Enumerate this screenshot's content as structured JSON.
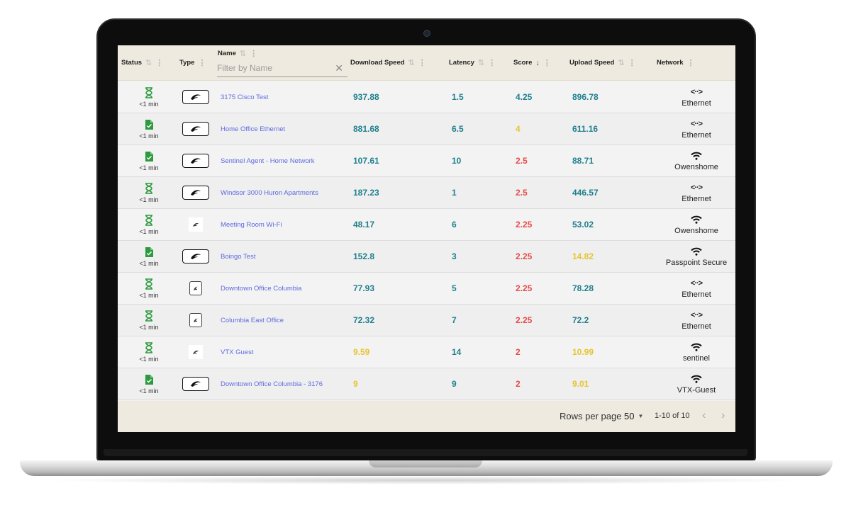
{
  "columns": {
    "status": "Status",
    "type": "Type",
    "name": "Name",
    "download": "Download Speed",
    "latency": "Latency",
    "score": "Score",
    "upload": "Upload Speed",
    "network": "Network"
  },
  "filter": {
    "placeholder": "Filter by Name",
    "value": ""
  },
  "colors": {
    "teal": "#1f7f8e",
    "yellow": "#e6c531",
    "red": "#e64b4b",
    "link": "#5d6be0",
    "header_bg": "#eeeadf"
  },
  "rows": [
    {
      "status_icon": "hourglass-icon",
      "status": "<1 min",
      "type_icon": "agent-device-icon",
      "name": "3175 Cisco Test",
      "download": "937.88",
      "download_color": "teal",
      "latency": "1.5",
      "score": "4.25",
      "score_color": "teal",
      "upload": "896.78",
      "upload_color": "teal",
      "network_icon": "ethernet-icon",
      "network": "Ethernet"
    },
    {
      "status_icon": "file-check-icon",
      "status": "<1 min",
      "type_icon": "agent-device-icon",
      "name": "Home Office Ethernet",
      "download": "881.68",
      "download_color": "teal",
      "latency": "6.5",
      "score": "4",
      "score_color": "yellow",
      "upload": "611.16",
      "upload_color": "teal",
      "network_icon": "ethernet-icon",
      "network": "Ethernet"
    },
    {
      "status_icon": "file-check-icon",
      "status": "<1 min",
      "type_icon": "agent-device-icon",
      "name": "Sentinel Agent - Home Network",
      "download": "107.61",
      "download_color": "teal",
      "latency": "10",
      "score": "2.5",
      "score_color": "red",
      "upload": "88.71",
      "upload_color": "teal",
      "network_icon": "wifi-icon",
      "network": "Owenshome"
    },
    {
      "status_icon": "hourglass-icon",
      "status": "<1 min",
      "type_icon": "agent-device-icon",
      "name": "Windsor 3000 Huron Apartments",
      "download": "187.23",
      "download_color": "teal",
      "latency": "1",
      "score": "2.5",
      "score_color": "red",
      "upload": "446.57",
      "upload_color": "teal",
      "network_icon": "ethernet-icon",
      "network": "Ethernet"
    },
    {
      "status_icon": "hourglass-icon",
      "status": "<1 min",
      "type_icon": "app-device-icon",
      "name": "Meeting Room Wi-Fi",
      "download": "48.17",
      "download_color": "teal",
      "latency": "6",
      "score": "2.25",
      "score_color": "red",
      "upload": "53.02",
      "upload_color": "teal",
      "network_icon": "wifi-icon",
      "network": "Owenshome"
    },
    {
      "status_icon": "file-check-icon",
      "status": "<1 min",
      "type_icon": "agent-device-icon",
      "name": "Boingo Test",
      "download": "152.8",
      "download_color": "teal",
      "latency": "3",
      "score": "2.25",
      "score_color": "red",
      "upload": "14.82",
      "upload_color": "yellow",
      "network_icon": "wifi-icon",
      "network": "Passpoint Secure"
    },
    {
      "status_icon": "hourglass-icon",
      "status": "<1 min",
      "type_icon": "phone-device-icon",
      "name": "Downtown Office Columbia",
      "download": "77.93",
      "download_color": "teal",
      "latency": "5",
      "score": "2.25",
      "score_color": "red",
      "upload": "78.28",
      "upload_color": "teal",
      "network_icon": "ethernet-icon",
      "network": "Ethernet"
    },
    {
      "status_icon": "hourglass-icon",
      "status": "<1 min",
      "type_icon": "phone-device-icon",
      "name": "Columbia East Office",
      "download": "72.32",
      "download_color": "teal",
      "latency": "7",
      "score": "2.25",
      "score_color": "red",
      "upload": "72.2",
      "upload_color": "teal",
      "network_icon": "ethernet-icon",
      "network": "Ethernet"
    },
    {
      "status_icon": "hourglass-icon",
      "status": "<1 min",
      "type_icon": "app-device-icon",
      "name": "VTX Guest",
      "download": "9.59",
      "download_color": "yellow",
      "latency": "14",
      "score": "2",
      "score_color": "red",
      "upload": "10.99",
      "upload_color": "yellow",
      "network_icon": "wifi-icon",
      "network": "sentinel"
    },
    {
      "status_icon": "file-check-icon",
      "status": "<1 min",
      "type_icon": "agent-device-icon",
      "name": "Downtown Office Columbia - 3176",
      "download": "9",
      "download_color": "yellow",
      "latency": "9",
      "score": "2",
      "score_color": "red",
      "upload": "9.01",
      "upload_color": "yellow",
      "network_icon": "wifi-icon",
      "network": "VTX-Guest"
    }
  ],
  "footer": {
    "rows_per_page_label": "Rows per page",
    "rows_per_page_value": "50",
    "range": "1-10 of 10"
  }
}
